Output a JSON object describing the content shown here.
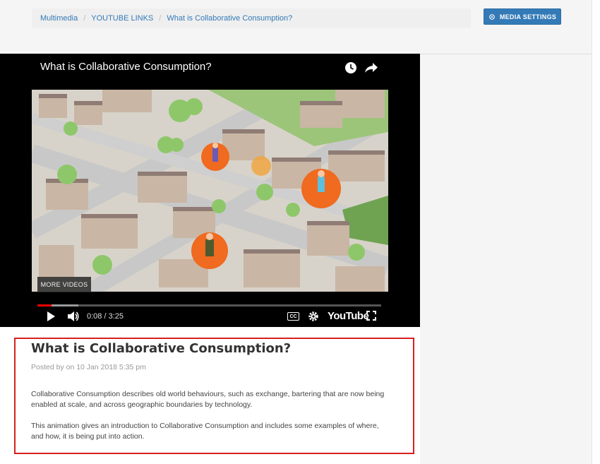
{
  "breadcrumb": {
    "items": [
      "Multimedia",
      "YOUTUBE LINKS",
      "What is Collaborative Consumption?"
    ],
    "separator": "/"
  },
  "header": {
    "media_settings_label": "MEDIA SETTINGS"
  },
  "player": {
    "title": "What is Collaborative Consumption?",
    "more_videos_label": "MORE VIDEOS",
    "time_display": "0:08 / 3:25",
    "progress_fraction": 0.041,
    "buffer_fraction": 0.12,
    "logo_text": "YouTube",
    "cc_label": "CC"
  },
  "post": {
    "title": "What is Collaborative Consumption?",
    "meta": "Posted by on 10 Jan 2018 5:35 pm",
    "paragraphs": [
      "Collaborative Consumption describes old world behaviours, such as exchange, bartering that are now being enabled at scale, and across geographic boundaries by technology.",
      "This animation gives an introduction to Collaborative Consumption and includes some examples of where, and how, it is being put into action."
    ]
  },
  "colors": {
    "accent": "#337ab7",
    "highlight_border": "#d62020",
    "progress_red": "#ee0000"
  }
}
